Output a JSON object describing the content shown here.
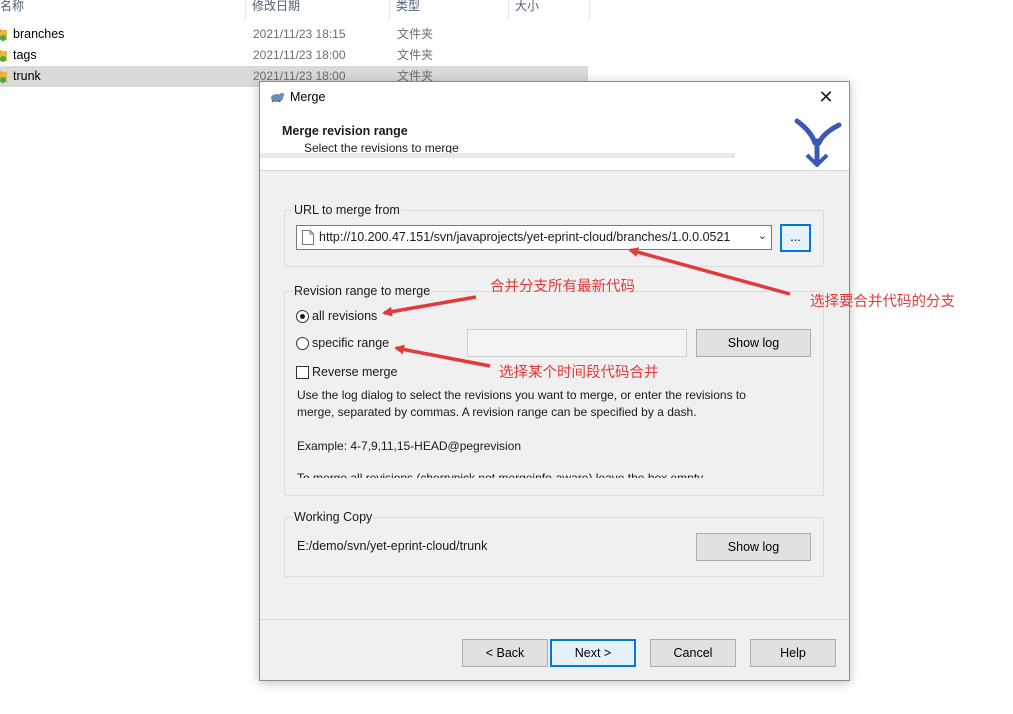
{
  "explorer": {
    "columns": [
      "名称",
      "修改日期",
      "类型",
      "大小"
    ],
    "rows": [
      {
        "name": "branches",
        "date": "2021/11/23 18:15",
        "type": "文件夹"
      },
      {
        "name": "tags",
        "date": "2021/11/23 18:00",
        "type": "文件夹"
      },
      {
        "name": "trunk",
        "date": "2021/11/23 18:00",
        "type": "文件夹"
      }
    ]
  },
  "dialog": {
    "title": "Merge",
    "header_title": "Merge revision range",
    "header_subtitle": "Select the revisions to merge",
    "url_group_label": "URL to merge from",
    "url_value": "http://10.200.47.151/svn/javaprojects/yet-eprint-cloud/branches/1.0.0.0521",
    "browse_label": "...",
    "range_group_label": "Revision range to merge",
    "all_revisions_label": "all revisions",
    "specific_range_label": "specific range",
    "show_log_label": "Show log",
    "reverse_merge_label": "Reverse merge",
    "help_line1": "Use the log dialog to select the revisions you want to merge, or enter the revisions to",
    "help_line2": "merge, separated by commas. A revision range can be specified by a dash.",
    "example": "Example: 4-7,9,11,15-HEAD@pegrevision",
    "cutoff_line": "To merge all revisions (cherrypick not mergeinfo-aware) leave the box empty",
    "wc_group_label": "Working Copy",
    "wc_path": "E:/demo/svn/yet-eprint-cloud/trunk",
    "wc_show_log_label": "Show log",
    "back_label": "< Back",
    "next_label": "Next >",
    "cancel_label": "Cancel",
    "help_label": "Help",
    "close_glyph": "✕",
    "all_revisions_selected": true,
    "reverse_merge_checked": false
  },
  "annotations": {
    "merge_all": "合并分支所有最新代码",
    "select_branch": "选择要合并代码的分支",
    "select_period": "选择某个时间段代码合并",
    "color": "#e03a3a"
  }
}
